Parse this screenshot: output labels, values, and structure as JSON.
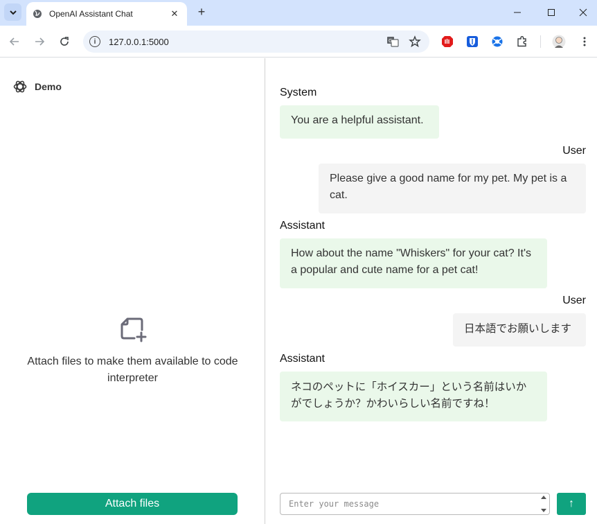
{
  "browser": {
    "tab_title": "OpenAI Assistant Chat",
    "tab_close": "✕",
    "new_tab": "+",
    "url": "127.0.0.1:5000",
    "window_controls": {
      "minimize": "—",
      "maximize": "☐",
      "close": "✕"
    }
  },
  "sidebar": {
    "brand_name": "Demo",
    "attach_text": "Attach files to make them available to code interpreter",
    "attach_button_label": "Attach files"
  },
  "chat": {
    "messages": [
      {
        "role": "System",
        "text": "You are a helpful assistant."
      },
      {
        "role": "User",
        "text": "Please give a good name for my pet. My pet is a cat."
      },
      {
        "role": "Assistant",
        "text": "How about the name \"Whiskers\" for your cat? It's a popular and cute name for a pet cat!"
      },
      {
        "role": "User",
        "text": "日本語でお願いします"
      },
      {
        "role": "Assistant",
        "text": "ネコのペットに「ホイスカー」という名前はいかがでしょうか？かわいらしい名前ですね！"
      }
    ],
    "input_placeholder": "Enter your message",
    "send_label": "↑"
  },
  "colors": {
    "accent": "#10a37f",
    "assistant_bubble": "#eaf8ea",
    "user_bubble": "#f4f4f4",
    "tabstrip": "#d3e3fd"
  }
}
